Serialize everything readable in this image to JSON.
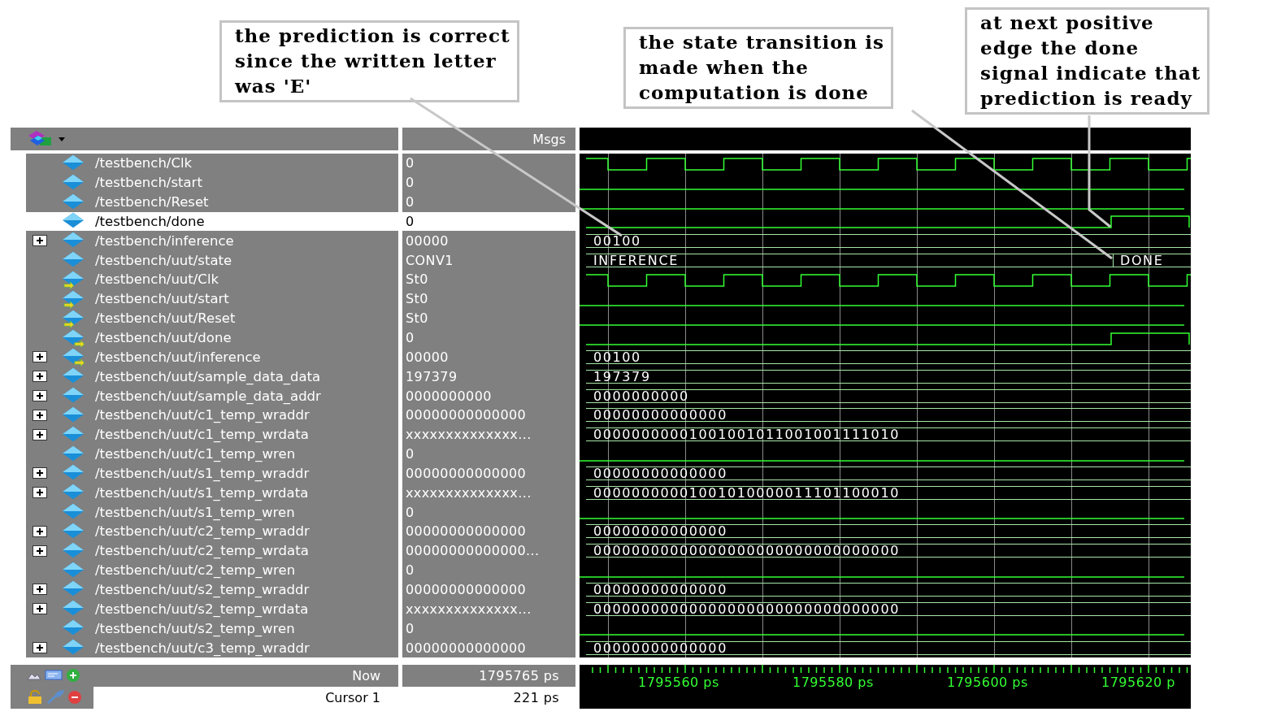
{
  "callouts": [
    {
      "text": "the prediction is correct\nsince the written letter\nwas 'E'"
    },
    {
      "text": "the state transition is\nmade when the\ncomputation is done"
    },
    {
      "text": "at next positive\nedge the done\nsignal indicate that\nprediction is ready"
    }
  ],
  "wave_window": {
    "header": {
      "value_column": "Msgs"
    },
    "signals": [
      {
        "name": "/testbench/Clk",
        "value": "0",
        "kind": "signal",
        "expandable": false,
        "selected": false,
        "wave": {
          "kind": "clock"
        }
      },
      {
        "name": "/testbench/start",
        "value": "0",
        "kind": "signal",
        "expandable": false,
        "selected": false,
        "wave": {
          "kind": "low"
        }
      },
      {
        "name": "/testbench/Reset",
        "value": "0",
        "kind": "signal",
        "expandable": false,
        "selected": false,
        "wave": {
          "kind": "low"
        }
      },
      {
        "name": "/testbench/done",
        "value": "0",
        "kind": "signal",
        "expandable": false,
        "selected": true,
        "wave": {
          "kind": "rise"
        }
      },
      {
        "name": "/testbench/inference",
        "value": "00000",
        "kind": "signal",
        "expandable": true,
        "selected": false,
        "wave": {
          "kind": "bus",
          "segments": [
            "00100"
          ]
        }
      },
      {
        "name": "/testbench/uut/state",
        "value": "CONV1",
        "kind": "signal",
        "expandable": false,
        "selected": false,
        "wave": {
          "kind": "bus",
          "segments": [
            "INFERENCE",
            "DONE"
          ]
        }
      },
      {
        "name": "/testbench/uut/Clk",
        "value": "St0",
        "kind": "input",
        "expandable": false,
        "selected": false,
        "wave": {
          "kind": "clock"
        }
      },
      {
        "name": "/testbench/uut/start",
        "value": "St0",
        "kind": "input",
        "expandable": false,
        "selected": false,
        "wave": {
          "kind": "low"
        }
      },
      {
        "name": "/testbench/uut/Reset",
        "value": "St0",
        "kind": "input",
        "expandable": false,
        "selected": false,
        "wave": {
          "kind": "low"
        }
      },
      {
        "name": "/testbench/uut/done",
        "value": "0",
        "kind": "output",
        "expandable": false,
        "selected": false,
        "wave": {
          "kind": "rise"
        }
      },
      {
        "name": "/testbench/uut/inference",
        "value": "00000",
        "kind": "output",
        "expandable": true,
        "selected": false,
        "wave": {
          "kind": "bus",
          "segments": [
            "00100"
          ]
        }
      },
      {
        "name": "/testbench/uut/sample_data_data",
        "value": "197379",
        "kind": "signal",
        "expandable": true,
        "selected": false,
        "wave": {
          "kind": "bus",
          "segments": [
            "197379"
          ]
        }
      },
      {
        "name": "/testbench/uut/sample_data_addr",
        "value": "0000000000",
        "kind": "signal",
        "expandable": true,
        "selected": false,
        "wave": {
          "kind": "bus",
          "segments": [
            "0000000000"
          ]
        }
      },
      {
        "name": "/testbench/uut/c1_temp_wraddr",
        "value": "00000000000000",
        "kind": "signal",
        "expandable": true,
        "selected": false,
        "wave": {
          "kind": "bus",
          "segments": [
            "00000000000000"
          ]
        }
      },
      {
        "name": "/testbench/uut/c1_temp_wrdata",
        "value": "xxxxxxxxxxxxxx...",
        "kind": "signal",
        "expandable": true,
        "selected": false,
        "wave": {
          "kind": "bus",
          "segments": [
            "00000000001001001011001001111010"
          ]
        }
      },
      {
        "name": "/testbench/uut/c1_temp_wren",
        "value": "0",
        "kind": "signal",
        "expandable": false,
        "selected": false,
        "wave": {
          "kind": "low"
        }
      },
      {
        "name": "/testbench/uut/s1_temp_wraddr",
        "value": "00000000000000",
        "kind": "signal",
        "expandable": true,
        "selected": false,
        "wave": {
          "kind": "bus",
          "segments": [
            "00000000000000"
          ]
        }
      },
      {
        "name": "/testbench/uut/s1_temp_wrdata",
        "value": "xxxxxxxxxxxxxx...",
        "kind": "signal",
        "expandable": true,
        "selected": false,
        "wave": {
          "kind": "bus",
          "segments": [
            "00000000001001010000011101100010"
          ]
        }
      },
      {
        "name": "/testbench/uut/s1_temp_wren",
        "value": "0",
        "kind": "signal",
        "expandable": false,
        "selected": false,
        "wave": {
          "kind": "low"
        }
      },
      {
        "name": "/testbench/uut/c2_temp_wraddr",
        "value": "00000000000000",
        "kind": "signal",
        "expandable": true,
        "selected": false,
        "wave": {
          "kind": "bus",
          "segments": [
            "00000000000000"
          ]
        }
      },
      {
        "name": "/testbench/uut/c2_temp_wrdata",
        "value": "00000000000000...",
        "kind": "signal",
        "expandable": true,
        "selected": false,
        "wave": {
          "kind": "bus",
          "segments": [
            "00000000000000000000000000000000"
          ]
        }
      },
      {
        "name": "/testbench/uut/c2_temp_wren",
        "value": "0",
        "kind": "signal",
        "expandable": false,
        "selected": false,
        "wave": {
          "kind": "low"
        }
      },
      {
        "name": "/testbench/uut/s2_temp_wraddr",
        "value": "00000000000000",
        "kind": "signal",
        "expandable": true,
        "selected": false,
        "wave": {
          "kind": "bus",
          "segments": [
            "00000000000000"
          ]
        }
      },
      {
        "name": "/testbench/uut/s2_temp_wrdata",
        "value": "xxxxxxxxxxxxxx...",
        "kind": "signal",
        "expandable": true,
        "selected": false,
        "wave": {
          "kind": "bus",
          "segments": [
            "00000000000000000000000000000000"
          ]
        }
      },
      {
        "name": "/testbench/uut/s2_temp_wren",
        "value": "0",
        "kind": "signal",
        "expandable": false,
        "selected": false,
        "wave": {
          "kind": "low"
        }
      },
      {
        "name": "/testbench/uut/c3_temp_wraddr",
        "value": "00000000000000",
        "kind": "signal",
        "expandable": true,
        "selected": false,
        "wave": {
          "kind": "bus",
          "segments": [
            "00000000000000"
          ]
        }
      }
    ],
    "footer": {
      "now": {
        "label": "Now",
        "value": "1795765 ps"
      },
      "cursor": {
        "label": "Cursor 1",
        "value": "221 ps"
      },
      "time_labels": [
        "1795560 ps",
        "1795580 ps",
        "1795600 ps",
        "1795620 p"
      ]
    }
  }
}
